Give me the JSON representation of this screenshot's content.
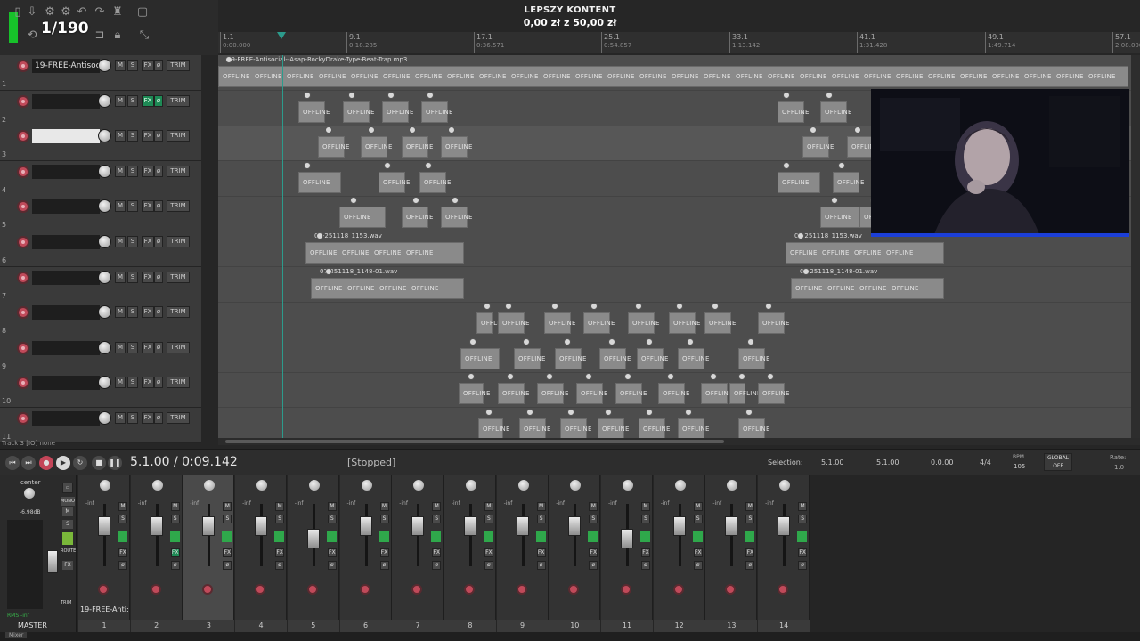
{
  "toolbar": {
    "grid_value": "1/190",
    "icons": [
      "save-icon",
      "undo-icon",
      "redo-icon",
      "lock-icon",
      "settings-icon",
      "metronome-icon"
    ]
  },
  "donation": {
    "title": "LEPSZY KONTENT",
    "amount": "0,00 zł z 50,00 zł",
    "progress": 0.0
  },
  "ruler": {
    "marks": [
      {
        "label": "1.1",
        "time": "0:00.000"
      },
      {
        "label": "9.1",
        "time": "0:18.285"
      },
      {
        "label": "17.1",
        "time": "0:36.571"
      },
      {
        "label": "25.1",
        "time": "0:54.857"
      },
      {
        "label": "33.1",
        "time": "1:13.142"
      },
      {
        "label": "41.1",
        "time": "1:31.428"
      },
      {
        "label": "49.1",
        "time": "1:49.714"
      },
      {
        "label": "57.1",
        "time": "2:08.000"
      }
    ]
  },
  "tracks": [
    {
      "num": "1",
      "name": "19-FREE-Antisocial",
      "fx_on": false
    },
    {
      "num": "2",
      "name": "",
      "fx_on": true
    },
    {
      "num": "3",
      "name": "",
      "fx_on": false,
      "selected": true
    },
    {
      "num": "4",
      "name": "",
      "fx_on": false
    },
    {
      "num": "5",
      "name": "",
      "fx_on": false
    },
    {
      "num": "6",
      "name": "",
      "fx_on": false
    },
    {
      "num": "7",
      "name": "",
      "fx_on": false
    },
    {
      "num": "8",
      "name": "",
      "fx_on": false
    },
    {
      "num": "9",
      "name": "",
      "fx_on": false
    },
    {
      "num": "10",
      "name": "",
      "fx_on": false
    },
    {
      "num": "11",
      "name": "",
      "fx_on": false
    }
  ],
  "track_buttons": {
    "mute": "M",
    "solo": "S",
    "fx": "FX",
    "phase": "ø",
    "trim": "TRIM"
  },
  "items": {
    "offline_label": "OFFLINE",
    "track1_title": "19-FREE-Antisocial--Asap-RockyDrake-Type-Beat-Trap.mp3",
    "track6_title": "07-251118_1153.wav",
    "track7_title": "07-251118_1148-01.wav"
  },
  "status": {
    "track_info": "Track 3 [IO] none"
  },
  "transport": {
    "time": "5.1.00 / 0:09.142",
    "state": "[Stopped]",
    "selection_label": "Selection:",
    "selection_start": "5.1.00",
    "selection_end": "5.1.00",
    "selection_length": "0.0.00",
    "time_sig": "4/4",
    "bpm_label": "BPM",
    "bpm": "105",
    "global_label": "GLOBAL",
    "global_state": "OFF",
    "rate_label": "Rate:",
    "rate": "1.0"
  },
  "mixer": {
    "master_label": "MASTER",
    "master_pan": "center",
    "master_vol": "-6.98dB",
    "master_rms": "RMS  -inf",
    "master_buttons": {
      "mono": "MONO",
      "route": "ROUTE",
      "trim": "TRIM"
    },
    "strip_inf": "-inf",
    "strip1_name": "19-FREE-Anti:",
    "strips": [
      "1",
      "2",
      "3",
      "4",
      "5",
      "6",
      "7",
      "8",
      "9",
      "10",
      "11",
      "12",
      "13",
      "14"
    ]
  },
  "bottom_tab": "Mixer",
  "colors": {
    "accent": "#2c9b8c",
    "record": "#c04a5a",
    "fx_on": "#1e8a55",
    "webcam_border": "#1c3fd8"
  }
}
